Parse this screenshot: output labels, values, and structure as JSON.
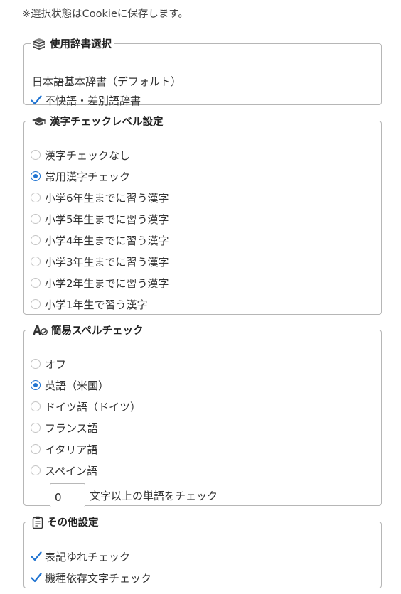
{
  "notice": "※選択状態はCookieに保存します。",
  "dictionary": {
    "legend": "使用辞書選択",
    "default_dict": "日本語基本辞書（デフォルト）",
    "options": [
      {
        "label": "不快語・差別語辞書",
        "checked": true
      }
    ]
  },
  "kanji": {
    "legend": "漢字チェックレベル設定",
    "options": [
      {
        "label": "漢字チェックなし",
        "selected": false
      },
      {
        "label": "常用漢字チェック",
        "selected": true
      },
      {
        "label": "小学6年生までに習う漢字",
        "selected": false
      },
      {
        "label": "小学5年生までに習う漢字",
        "selected": false
      },
      {
        "label": "小学4年生までに習う漢字",
        "selected": false
      },
      {
        "label": "小学3年生までに習う漢字",
        "selected": false
      },
      {
        "label": "小学2年生までに習う漢字",
        "selected": false
      },
      {
        "label": "小学1年生で習う漢字",
        "selected": false
      }
    ]
  },
  "spell": {
    "legend": "簡易スペルチェック",
    "options": [
      {
        "label": "オフ",
        "selected": false
      },
      {
        "label": "英語（米国）",
        "selected": true
      },
      {
        "label": "ドイツ語（ドイツ）",
        "selected": false
      },
      {
        "label": "フランス語",
        "selected": false
      },
      {
        "label": "イタリア語",
        "selected": false
      },
      {
        "label": "スペイン語",
        "selected": false
      }
    ],
    "min_length_value": "0",
    "min_length_label": "文字以上の単語をチェック"
  },
  "other": {
    "legend": "その他設定",
    "options": [
      {
        "label": "表記ゆれチェック",
        "checked": true
      },
      {
        "label": "機種依存文字チェック",
        "checked": true
      }
    ]
  },
  "colors": {
    "accent": "#1f73d1",
    "border": "#b6b6b6",
    "dashed_outline": "#7a9cd6"
  },
  "icons": {
    "dictionary": "books-icon",
    "kanji": "graduation-cap-icon",
    "spell": "spellcheck-icon",
    "other": "clipboard-icon",
    "checkbox": "checkmark-icon"
  }
}
